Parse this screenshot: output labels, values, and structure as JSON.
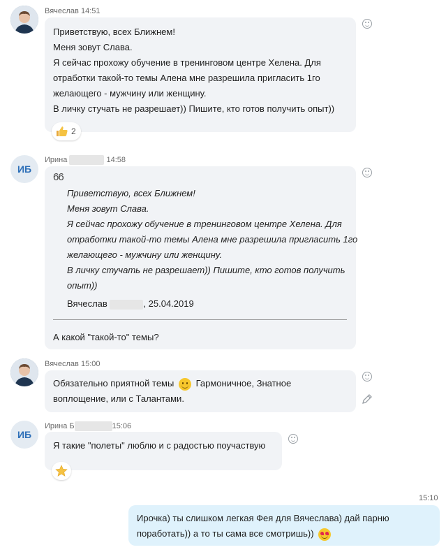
{
  "messages": [
    {
      "author": "Вячеслав",
      "time": "14:51",
      "lines": [
        "Приветствую, всех Ближнем!",
        "Меня зовут Слава.",
        "Я сейчас прохожу обучение в тренинговом центре Хелена. Для",
        "отработки такой-то темы Алена мне разрешила пригласить 1го",
        "желающего - мужчину или женщину.",
        "В личку стучать не разрешает)) Пишите, кто готов получить опыт))"
      ],
      "reaction": {
        "icon": "thumbs-up-icon",
        "count": "2"
      }
    },
    {
      "avatar": "ИБ",
      "author": "Ирина",
      "time": "14:58",
      "quote_mark": "66",
      "quote_lines": [
        "Приветствую, всех Ближнем!",
        "Меня зовут Слава.",
        "Я сейчас прохожу обучение в тренинговом центре Хелена. Для",
        "отработки такой-то темы Алена мне разрешила пригласить 1го",
        "желающего - мужчину или женщину.",
        "В личку стучать не разрешает)) Пишите, кто готов получить",
        "опыт))"
      ],
      "quote_author": "Вячеслав",
      "quote_date": ", 25.04.2019",
      "reply": "А какой \"такой-то\" темы?"
    },
    {
      "author": "Вячеслав",
      "time": "15:00",
      "line1_a": "Обязательно приятной темы",
      "line1_b": "Гармоничное, Знатное",
      "line2": "воплощение, или с Талантами."
    },
    {
      "avatar": "ИБ",
      "author": "Ирина Б",
      "time": "15:06",
      "text": "Я такие \"полеты\" люблю и с радостью поучаствую",
      "reaction": {
        "icon": "star-icon"
      }
    },
    {
      "time": "15:10",
      "line1": "Ирочка) ты слишком легкая Фея для Вячеслава) дай парню",
      "line2": "поработать)) а то ты сама все смотришь))"
    }
  ],
  "colors": {
    "incoming": "#f1f3f6",
    "outgoing": "#dff2fc",
    "initials": "#2d6fb8"
  }
}
